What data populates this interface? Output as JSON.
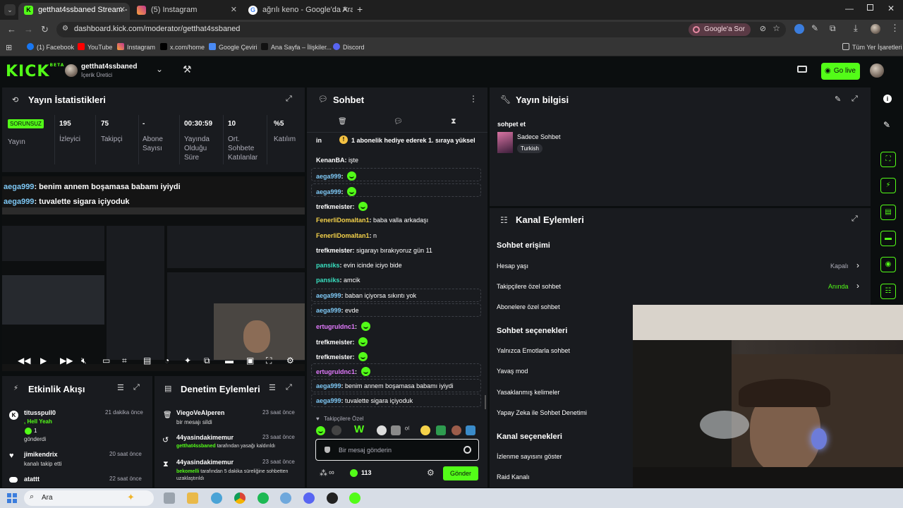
{
  "browser": {
    "tabs": [
      {
        "title": "getthat4ssbaned Stream - Kick"
      },
      {
        "title": "(5) Instagram"
      },
      {
        "title": "ağrılı keno - Google'da Ara"
      }
    ],
    "url": "dashboard.kick.com/moderator/getthat4ssbaned",
    "google_ask": "Google'a Sor",
    "bookmarks": [
      "(1) Facebook",
      "YouTube",
      "Instagram",
      "x.com/home",
      "Google Çeviri",
      "Ana Sayfa – İlişkiler...",
      "Discord"
    ],
    "all_bookmarks": "Tüm Yer İşaretleri"
  },
  "header": {
    "logo": "KICK",
    "logo_badge": "BETA",
    "channel_name": "getthat4ssbaned",
    "channel_role": "İçerik Üretici",
    "go_live": "Go live"
  },
  "stats": {
    "title": "Yayın İstatistikleri",
    "status_badge": "SORUNSUZ",
    "status_label": "Yayın",
    "items": [
      {
        "value": "195",
        "label": "İzleyici"
      },
      {
        "value": "75",
        "label": "Takipçi"
      },
      {
        "value": "-",
        "label": "Abone Sayısı"
      },
      {
        "value": "00:30:59",
        "label": "Yayında Olduğu Süre"
      },
      {
        "value": "10",
        "label": "Ort. Sohbete Katılanlar"
      },
      {
        "value": "%5",
        "label": "Katılım"
      }
    ]
  },
  "overlay": {
    "line1_user": "aega999",
    "line1_text": ": benim annem boşamasa babamı iyiydi",
    "line2_user": "aega999",
    "line2_text": ": tuvalette sigara içiyoduk"
  },
  "activity": {
    "title": "Etkinlik Akışı",
    "items": [
      {
        "user": "titusspull0",
        "extra": ", Hell Yeah",
        "count": "1",
        "action": "gönderdi",
        "time": "21 dakika önce"
      },
      {
        "user": "jimikendrix",
        "action": "kanalı takip etti",
        "time": "20 saat önce"
      },
      {
        "user": "atattt",
        "action": "",
        "time": "22 saat önce"
      }
    ]
  },
  "moderation": {
    "title": "Denetim Eylemleri",
    "items": [
      {
        "user": "ViegoVeAlperen",
        "desc": "bir mesajı sildi",
        "actor": "",
        "time": "23 saat önce"
      },
      {
        "user": "44yasindakimemur",
        "actor": "getthat4ssbaned",
        "desc": "tarafından yasağı kaldırıldı",
        "time": "23 saat önce"
      },
      {
        "user": "44yasindakimemur",
        "actor": "bekomelli",
        "desc": "tarafından 5 dakika süreliğine sohbetten uzaklaştırıldı",
        "time": "23 saat önce"
      }
    ]
  },
  "chat": {
    "title": "Sohbet",
    "pinned_prefix": "in",
    "pinned": "1 abonelik hediye ederek 1. sıraya yüksel",
    "messages": [
      {
        "user": "KenanBA",
        "color": "white",
        "text": "işte",
        "emote": false,
        "hl": false
      },
      {
        "user": "aega999",
        "color": "blue",
        "text": "",
        "emote": true,
        "hl": true
      },
      {
        "user": "aega999",
        "color": "blue",
        "text": "",
        "emote": true,
        "hl": true
      },
      {
        "user": "trefkmeister",
        "color": "white",
        "text": "",
        "emote": true,
        "hl": false
      },
      {
        "user": "FenerliDomaltan1",
        "color": "yellow",
        "text": "baba valla arkadaşı",
        "emote": false,
        "hl": false
      },
      {
        "user": "FenerliDomaltan1",
        "color": "yellow",
        "text": "n",
        "emote": false,
        "hl": false
      },
      {
        "user": "trefkmeister",
        "color": "white",
        "text": "sigarayı bırakıyoruz gün 11",
        "emote": false,
        "hl": false
      },
      {
        "user": "pansiks",
        "color": "cyan",
        "text": "evin icinde iciyo bide",
        "emote": false,
        "hl": false
      },
      {
        "user": "pansiks",
        "color": "cyan",
        "text": "amcik",
        "emote": false,
        "hl": false
      },
      {
        "user": "aega999",
        "color": "blue",
        "text": "baban içiyorsa sıkıntı yok",
        "emote": false,
        "hl": true
      },
      {
        "user": "aega999",
        "color": "blue",
        "text": "evde",
        "emote": false,
        "hl": true
      },
      {
        "user": "ertugruldnc1",
        "color": "pink",
        "text": "",
        "emote": true,
        "hl": false
      },
      {
        "user": "trefkmeister",
        "color": "white",
        "text": "",
        "emote": true,
        "hl": false
      },
      {
        "user": "trefkmeister",
        "color": "white",
        "text": "",
        "emote": true,
        "hl": false
      },
      {
        "user": "ertugruldnc1",
        "color": "pink",
        "text": "",
        "emote": true,
        "hl": true
      },
      {
        "user": "aega999",
        "color": "blue",
        "text": "benim annem boşamasa babamı iyiydi",
        "emote": false,
        "hl": true
      },
      {
        "user": "aega999",
        "color": "blue",
        "text": "tuvalette sigara içiyoduk",
        "emote": false,
        "hl": true
      }
    ],
    "followers_only": "Takipçilere Özel",
    "input_placeholder": "Bir mesaj gönderin",
    "points": "113",
    "send": "Gönder"
  },
  "stream_info": {
    "title": "Yayın bilgisi",
    "stream_title": "sohpet et",
    "category": "Sadece Sohbet",
    "tag": "Turkish"
  },
  "channel_actions": {
    "title": "Kanal Eylemleri",
    "chat_access": "Sohbet erişimi",
    "account_age": "Hesap yaşı",
    "account_age_value": "Kapalı",
    "followers_only": "Takipçilere özel sohbet",
    "followers_only_value": "Anında",
    "subs_only": "Abonelere özel sohbet",
    "chat_options": "Sohbet seçenekleri",
    "emotes_only": "Yalnızca Emotlarla sohbet",
    "slow_mode": "Yavaş mod",
    "banned_words": "Yasaklanmış kelimeler",
    "ai_mod": "Yapay Zeka ile Sohbet Denetimi",
    "channel_options": "Kanal seçenekleri",
    "show_viewers": "İzlenme sayısını göster",
    "raid": "Raid Kanalı"
  },
  "taskbar": {
    "search": "Ara"
  },
  "colors": {
    "kick_green": "#53fc18",
    "panel": "#191b1f",
    "bg": "#0b0e0f"
  }
}
